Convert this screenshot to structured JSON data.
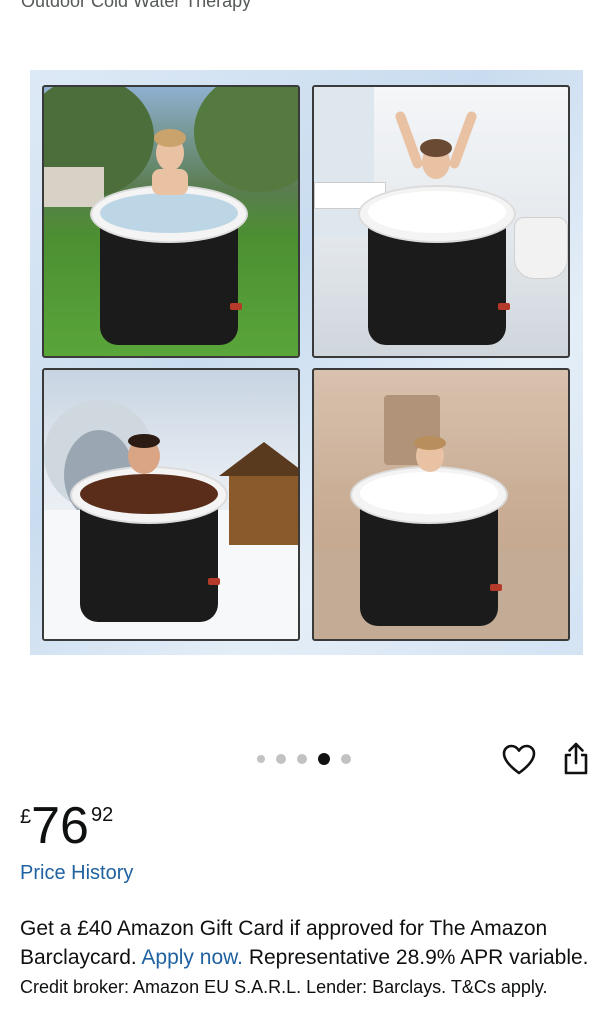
{
  "product": {
    "subtitle": "Outdoor Cold Water Therapy"
  },
  "gallery": {
    "image_count": 5,
    "active_index": 3
  },
  "actions": {
    "wishlist_icon": "heart-outline-icon",
    "share_icon": "share-icon"
  },
  "price": {
    "currency": "£",
    "whole": "76",
    "fraction": "92"
  },
  "price_history_link": "Price History",
  "offer": {
    "text": "Get a £40 Amazon Gift Card if approved for The Amazon Barclaycard.",
    "apply_link": "Apply now.",
    "apr_text": "Representative 28.9% APR variable.",
    "fine_print": "Credit broker: Amazon EU S.A.R.L. Lender: Barclays. T&Cs apply."
  },
  "colors": {
    "link": "#2162a1",
    "text": "#0f1111",
    "muted": "#565959"
  }
}
